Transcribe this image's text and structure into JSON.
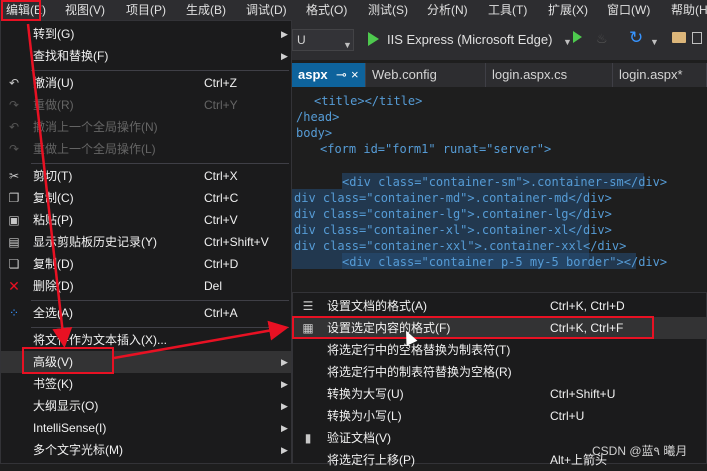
{
  "menubar": {
    "items": [
      {
        "label": "编辑(E)"
      },
      {
        "label": "视图(V)"
      },
      {
        "label": "项目(P)"
      },
      {
        "label": "生成(B)"
      },
      {
        "label": "调试(D)"
      },
      {
        "label": "格式(O)"
      },
      {
        "label": "测试(S)"
      },
      {
        "label": "分析(N)"
      },
      {
        "label": "工具(T)"
      },
      {
        "label": "扩展(X)"
      },
      {
        "label": "窗口(W)"
      },
      {
        "label": "帮助(H)"
      }
    ]
  },
  "toolbar": {
    "config_value": "U",
    "run_label": "IIS Express (Microsoft Edge)"
  },
  "tabs": [
    {
      "label": "aspx"
    },
    {
      "label": "Web.config"
    },
    {
      "label": "login.aspx.cs"
    },
    {
      "label": "login.aspx*"
    }
  ],
  "editor": {
    "lines": [
      "<title></title>",
      "/head>",
      "body>",
      "<form id=\"form1\" runat=\"server\">",
      "<div class=\"container-sm\">.container-sm</div>",
      "div class=\"container-md\">.container-md</div>",
      "div class=\"container-lg\">.container-lg</div>",
      "div class=\"container-xl\">.container-xl</div>",
      "div class=\"container-xxl\">.container-xxl</div>",
      "<div class=\"container p-5 my-5 border\"></div>"
    ]
  },
  "edit_menu": {
    "items": [
      {
        "label": "转到(G)",
        "shortcut": "",
        "submenu": true,
        "disabled": false,
        "icon": ""
      },
      {
        "label": "查找和替换(F)",
        "shortcut": "",
        "submenu": true,
        "disabled": false,
        "icon": ""
      },
      {
        "label": "撤消(U)",
        "shortcut": "Ctrl+Z",
        "submenu": false,
        "disabled": false,
        "icon": "undo-icon"
      },
      {
        "label": "重做(R)",
        "shortcut": "Ctrl+Y",
        "submenu": false,
        "disabled": true,
        "icon": "redo-icon"
      },
      {
        "label": "撤消上一个全局操作(N)",
        "shortcut": "",
        "submenu": false,
        "disabled": true,
        "icon": "undo-global-icon"
      },
      {
        "label": "重做上一个全局操作(L)",
        "shortcut": "",
        "submenu": false,
        "disabled": true,
        "icon": "redo-global-icon"
      },
      {
        "label": "剪切(T)",
        "shortcut": "Ctrl+X",
        "submenu": false,
        "disabled": false,
        "icon": "cut-icon"
      },
      {
        "label": "复制(C)",
        "shortcut": "Ctrl+C",
        "submenu": false,
        "disabled": false,
        "icon": "copy-icon"
      },
      {
        "label": "粘贴(P)",
        "shortcut": "Ctrl+V",
        "submenu": false,
        "disabled": false,
        "icon": "paste-icon"
      },
      {
        "label": "显示剪贴板历史记录(Y)",
        "shortcut": "Ctrl+Shift+V",
        "submenu": false,
        "disabled": false,
        "icon": "clipboard-history-icon"
      },
      {
        "label": "复制(D)",
        "shortcut": "Ctrl+D",
        "submenu": false,
        "disabled": false,
        "icon": "duplicate-icon"
      },
      {
        "label": "删除(D)",
        "shortcut": "Del",
        "submenu": false,
        "disabled": false,
        "icon": "delete-icon"
      },
      {
        "label": "全选(A)",
        "shortcut": "Ctrl+A",
        "submenu": false,
        "disabled": false,
        "icon": "select-all-icon"
      },
      {
        "label": "将文件作为文本插入(X)...",
        "shortcut": "",
        "submenu": false,
        "disabled": false,
        "icon": ""
      },
      {
        "label": "高级(V)",
        "shortcut": "",
        "submenu": true,
        "disabled": false,
        "icon": ""
      },
      {
        "label": "书签(K)",
        "shortcut": "",
        "submenu": true,
        "disabled": false,
        "icon": ""
      },
      {
        "label": "大纲显示(O)",
        "shortcut": "",
        "submenu": true,
        "disabled": false,
        "icon": ""
      },
      {
        "label": "IntelliSense(I)",
        "shortcut": "",
        "submenu": true,
        "disabled": false,
        "icon": ""
      },
      {
        "label": "多个文字光标(M)",
        "shortcut": "",
        "submenu": true,
        "disabled": false,
        "icon": ""
      }
    ]
  },
  "advanced_menu": {
    "items": [
      {
        "label": "设置文档的格式(A)",
        "shortcut": "Ctrl+K, Ctrl+D",
        "icon": "format-document-icon"
      },
      {
        "label": "设置选定内容的格式(F)",
        "shortcut": "Ctrl+K, Ctrl+F",
        "icon": "format-selection-icon"
      },
      {
        "label": "将选定行中的空格替换为制表符(T)",
        "shortcut": "",
        "icon": ""
      },
      {
        "label": "将选定行中的制表符替换为空格(R)",
        "shortcut": "",
        "icon": ""
      },
      {
        "label": "转换为大写(U)",
        "shortcut": "Ctrl+Shift+U",
        "icon": ""
      },
      {
        "label": "转换为小写(L)",
        "shortcut": "Ctrl+U",
        "icon": ""
      },
      {
        "label": "验证文档(V)",
        "shortcut": "",
        "icon": "validate-icon"
      },
      {
        "label": "将选定行上移(P)",
        "shortcut": "Alt+上箭头",
        "icon": ""
      }
    ]
  },
  "watermark": "CSDN @蓝٩ 曦月",
  "colors": {
    "annotation": "#e81123",
    "accent": "#4ec94e"
  }
}
